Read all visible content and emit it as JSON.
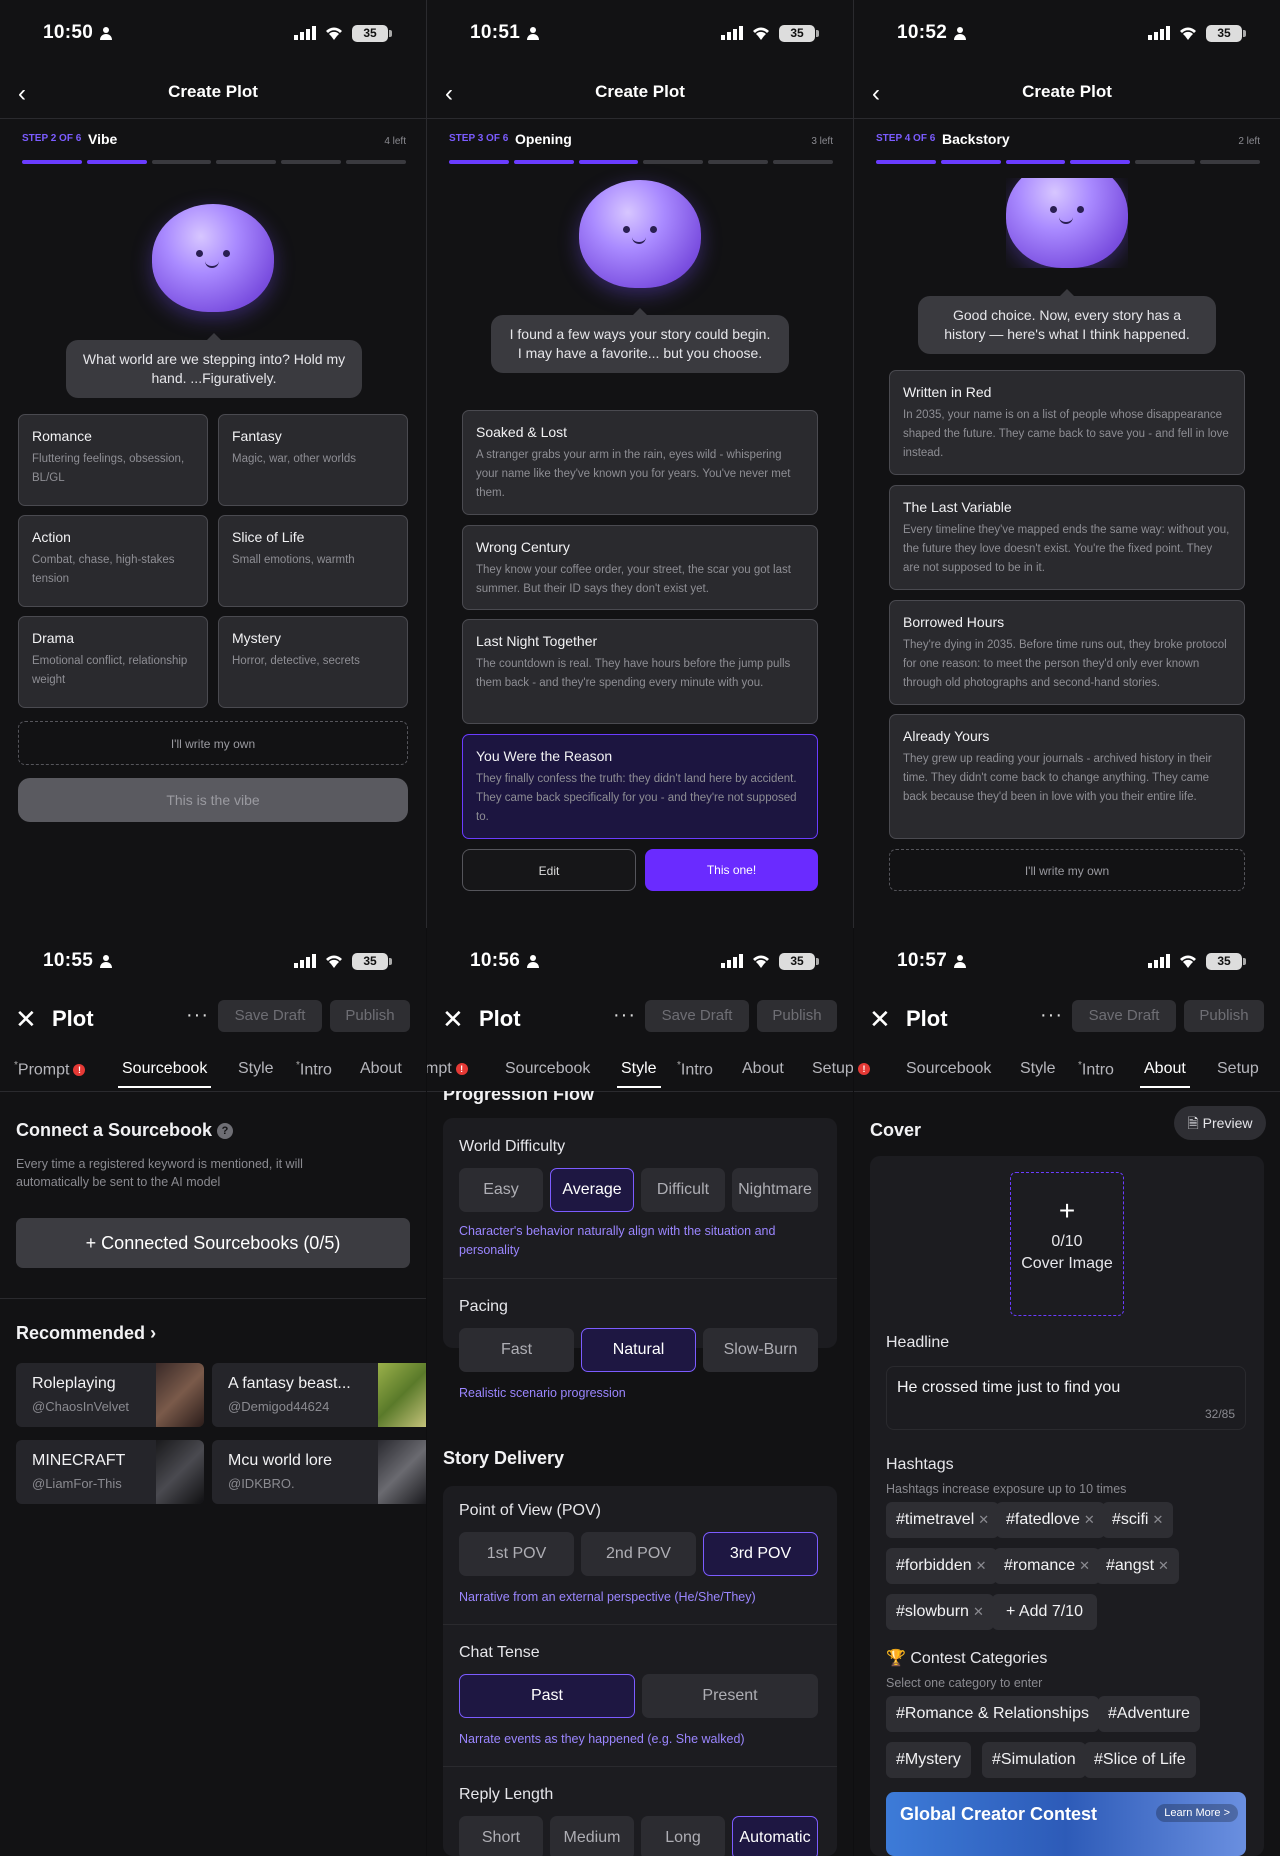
{
  "status": {
    "times": [
      "10:50",
      "10:51",
      "10:52",
      "10:55",
      "10:56",
      "10:57"
    ],
    "battery": "35"
  },
  "create": {
    "title": "Create Plot",
    "steps": [
      {
        "step": "STEP 2 OF 6",
        "name": "Vibe",
        "left": "4 left",
        "bubble": "What world are we stepping into? Hold my hand. ...Figuratively.",
        "filled": 2
      },
      {
        "step": "STEP 3 OF 6",
        "name": "Opening",
        "left": "3 left",
        "bubble": "I found a few ways your story could begin. I may have a favorite... but you choose.",
        "filled": 3
      },
      {
        "step": "STEP 4 OF 6",
        "name": "Backstory",
        "left": "2 left",
        "bubble": "Good choice. Now, every story has a history — here's what I think happened.",
        "filled": 4
      }
    ]
  },
  "vibe": {
    "cards": [
      {
        "title": "Romance",
        "desc": "Fluttering feelings, obsession, BL/GL"
      },
      {
        "title": "Fantasy",
        "desc": "Magic, war, other worlds"
      },
      {
        "title": "Action",
        "desc": "Combat, chase, high-stakes tension"
      },
      {
        "title": "Slice of Life",
        "desc": "Small emotions, warmth"
      },
      {
        "title": "Drama",
        "desc": "Emotional conflict, relationship weight"
      },
      {
        "title": "Mystery",
        "desc": "Horror, detective, secrets"
      }
    ],
    "own": "I'll write my own",
    "cta": "This is the vibe"
  },
  "opening": {
    "cards": [
      {
        "title": "Soaked & Lost",
        "desc": "A stranger grabs your arm in the rain, eyes wild - whispering your name like they've known you for years. You've never met them."
      },
      {
        "title": "Wrong Century",
        "desc": "They know your coffee order, your street, the scar you got last summer. But their ID says they don't exist yet."
      },
      {
        "title": "Last Night Together",
        "desc": "The countdown is real. They have hours before the jump pulls them back - and they're spending every minute with you."
      },
      {
        "title": "You Were the Reason",
        "desc": "They finally confess the truth: they didn't land here by accident. They came back specifically for you - and they're not supposed to."
      }
    ],
    "edit": "Edit",
    "choose": "This one!"
  },
  "backstory": {
    "cards": [
      {
        "title": "Written in Red",
        "desc": "In 2035, your name is on a list of people whose disappearance shaped the future. They came back to save you - and fell in love instead."
      },
      {
        "title": "The Last Variable",
        "desc": "Every timeline they've mapped ends the same way: without you, the future they love doesn't exist. You're the fixed point. They are not supposed to be in it."
      },
      {
        "title": "Borrowed Hours",
        "desc": "They're dying in 2035. Before time runs out, they broke protocol for one reason: to meet the person they'd only ever known through old photographs and second-hand stories."
      },
      {
        "title": "Already Yours",
        "desc": "They grew up reading your journals - archived history in their time. They didn't come back to change anything. They came back because they'd been in love with you their entire life."
      }
    ],
    "own": "I'll write my own"
  },
  "editor": {
    "title": "Plot",
    "dots": "···",
    "save": "Save Draft",
    "publish": "Publish",
    "tabs": {
      "prompt": "Prompt",
      "sourcebook": "Sourcebook",
      "style": "Style",
      "intro": "Intro",
      "about": "About",
      "setup": "Setup",
      "mpt": "mpt"
    }
  },
  "sourcebook": {
    "heading": "Connect a Sourcebook",
    "help": "?",
    "desc": "Every time a registered keyword is mentioned, it will automatically be sent to the AI model",
    "connect": "+ Connected Sourcebooks (0/5)",
    "recommended": "Recommended",
    "items": [
      {
        "name": "Roleplaying",
        "user": "@ChaosInVelvet"
      },
      {
        "name": "A fantasy beast...",
        "user": "@Demigod44624"
      },
      {
        "name": "MINECRAFT",
        "user": "@LiamFor-This"
      },
      {
        "name": "Mcu world lore",
        "user": "@IDKBRO."
      }
    ]
  },
  "style": {
    "partial": "Progression Flow",
    "difficulty": {
      "label": "World Difficulty",
      "options": [
        "Easy",
        "Average",
        "Difficult",
        "Nightmare"
      ],
      "selected": "Average",
      "hint": "Character's behavior naturally align with the situation and personality"
    },
    "pacing": {
      "label": "Pacing",
      "options": [
        "Fast",
        "Natural",
        "Slow-Burn"
      ],
      "selected": "Natural",
      "hint": "Realistic scenario progression"
    },
    "delivery": "Story Delivery",
    "pov": {
      "label": "Point of View (POV)",
      "options": [
        "1st POV",
        "2nd POV",
        "3rd POV"
      ],
      "selected": "3rd POV",
      "hint": "Narrative from an external perspective (He/She/They)"
    },
    "tense": {
      "label": "Chat Tense",
      "options": [
        "Past",
        "Present"
      ],
      "selected": "Past",
      "hint": "Narrate events as they happened (e.g. She walked)"
    },
    "reply": {
      "label": "Reply Length",
      "options": [
        "Short",
        "Medium",
        "Long",
        "Automatic"
      ],
      "selected": "Automatic"
    }
  },
  "about": {
    "preview": "Preview",
    "cover": "Cover",
    "plus": "+",
    "count": "0/10",
    "coverImage": "Cover Image",
    "headline": "Headline",
    "headlineValue": "He crossed time just to find you",
    "headlineCount": "32/85",
    "hashtags": "Hashtags",
    "hashHint": "Hashtags increase exposure up to 10 times",
    "tags": [
      "timetravel",
      "fatedlove",
      "scifi",
      "forbidden",
      "romance",
      "angst",
      "slowburn"
    ],
    "addTag": "+ Add 7/10",
    "contest": "Contest Categories",
    "contestHint": "Select one category to enter",
    "categories": [
      "#Romance & Relationships",
      "#Adventure",
      "#Mystery",
      "#Simulation",
      "#Slice of Life"
    ],
    "banner": "Global Creator Contest",
    "learn": "Learn More >"
  },
  "colors": {
    "accent": "#6a2bff",
    "selected": "#7c5cff",
    "hint": "#9b86ff"
  }
}
